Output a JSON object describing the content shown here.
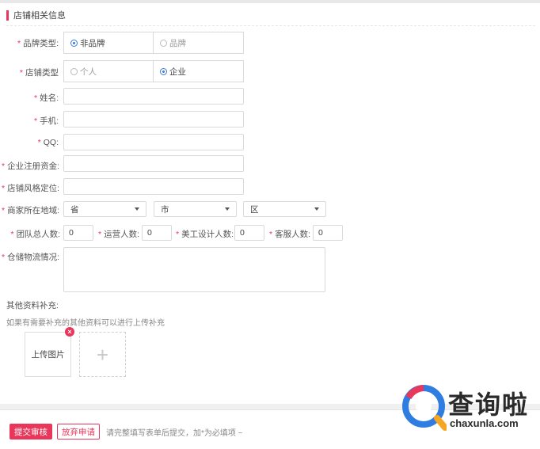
{
  "section": {
    "title": "店铺相关信息"
  },
  "form": {
    "brand_type": {
      "label": "品牌类型:",
      "options": [
        {
          "label": "非品牌",
          "selected": true
        },
        {
          "label": "品牌",
          "selected": false
        }
      ]
    },
    "shop_type": {
      "label": "店铺类型",
      "options": [
        {
          "label": "个人",
          "selected": false
        },
        {
          "label": "企业",
          "selected": true
        }
      ]
    },
    "name": {
      "label": "姓名:",
      "value": ""
    },
    "phone": {
      "label": "手机:",
      "value": ""
    },
    "qq": {
      "label": "QQ:",
      "value": ""
    },
    "capital": {
      "label": "企业注册资金:",
      "value": ""
    },
    "style": {
      "label": "店铺风格定位:",
      "value": ""
    },
    "location": {
      "label": "商家所在地域:",
      "province": "省",
      "city": "市",
      "district": "区"
    },
    "counts": {
      "team": {
        "label": "团队总人数:",
        "value": "0"
      },
      "ops": {
        "label": "运营人数:",
        "value": "0"
      },
      "design": {
        "label": "美工设计人数:",
        "value": "0"
      },
      "service": {
        "label": "客服人数:",
        "value": "0"
      }
    },
    "logistics": {
      "label": "仓储物流情况:",
      "value": ""
    }
  },
  "extra": {
    "title": "其他资料补充:",
    "hint": "如果有需要补充的其他资料可以进行上传补充",
    "upload_label": "上传图片",
    "close_glyph": "×",
    "add_glyph": "+"
  },
  "footer": {
    "submit": "提交审核",
    "abandon": "放弃申请",
    "hint": "请完整填写表单后提交，加*为必填项 ~"
  },
  "watermark": {
    "text": "查询啦",
    "url": "chaxunla.com",
    "colors": [
      "#e8375a",
      "#2f7de1",
      "#f5a623"
    ]
  },
  "colors": {
    "accent": "#e8375a",
    "radio": "#3a7bd5"
  }
}
